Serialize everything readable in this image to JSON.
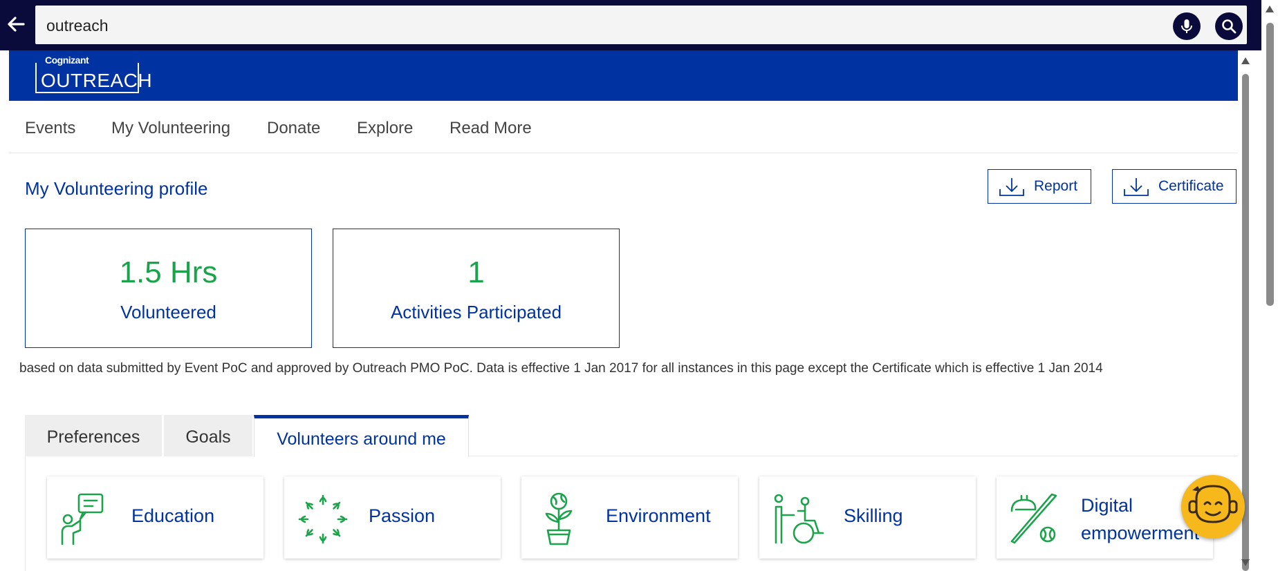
{
  "search": {
    "value": "outreach"
  },
  "header": {
    "logo_small": "Cognizant",
    "logo_main": "OUTREACH"
  },
  "nav": {
    "items": [
      {
        "label": "Events"
      },
      {
        "label": "My Volunteering"
      },
      {
        "label": "Donate"
      },
      {
        "label": "Explore"
      },
      {
        "label": "Read More"
      }
    ]
  },
  "profile": {
    "title": "My Volunteering profile",
    "report_label": "Report",
    "certificate_label": "Certificate",
    "stats": [
      {
        "value": "1.5 Hrs",
        "label": "Volunteered"
      },
      {
        "value": "1",
        "label": "Activities Participated"
      }
    ],
    "note": "based on data submitted by Event PoC and approved by Outreach PMO PoC. Data is effective 1 Jan 2017 for all instances in this page except the Certificate which is effective 1 Jan 2014"
  },
  "tabs": [
    {
      "label": "Preferences"
    },
    {
      "label": "Goals"
    },
    {
      "label": "Volunteers around me"
    }
  ],
  "active_tab": "Volunteers around me",
  "categories": [
    {
      "label": "Education",
      "icon": "education-icon"
    },
    {
      "label": "Passion",
      "icon": "passion-icon"
    },
    {
      "label": "Environment",
      "icon": "environment-icon"
    },
    {
      "label": "Skilling",
      "icon": "skilling-icon"
    },
    {
      "label_line1": "Digital",
      "label_line2": "empowerment",
      "icon": "digital-empowerment-icon"
    }
  ],
  "colors": {
    "brand_blue": "#0033a1",
    "topbar": "#0b0b3b",
    "stat_green": "#1aa34a",
    "icon_green": "#1aa34a",
    "bot_yellow": "#f6b81a"
  }
}
